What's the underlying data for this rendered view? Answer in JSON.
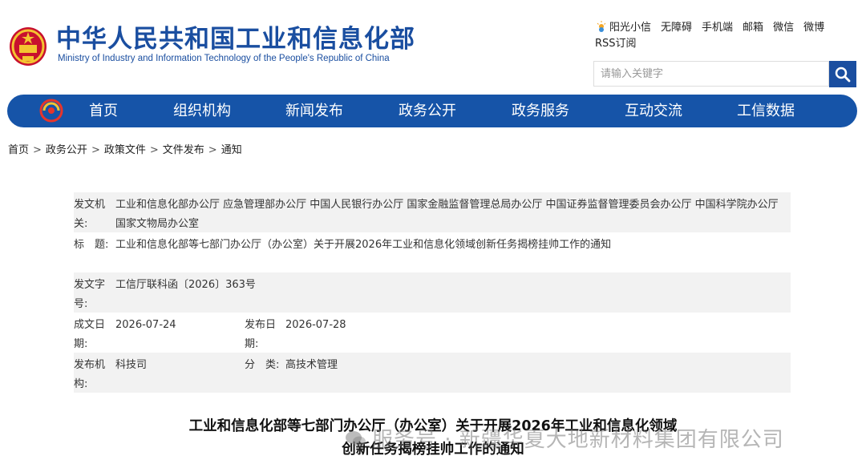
{
  "header": {
    "title": "中华人民共和国工业和信息化部",
    "subtitle": "Ministry of Industry and Information Technology of the People's Republic of China",
    "top_links": [
      "阳光小信",
      "无障碍",
      "手机端",
      "邮箱",
      "微信",
      "微博",
      "RSS订阅"
    ],
    "search_placeholder": "请输入关键字"
  },
  "nav": {
    "items": [
      "首页",
      "组织机构",
      "新闻发布",
      "政务公开",
      "政务服务",
      "互动交流",
      "工信数据"
    ]
  },
  "breadcrumb": [
    "首页",
    "政务公开",
    "政策文件",
    "文件发布",
    "通知"
  ],
  "meta": {
    "issuer_label": "发文机关:",
    "issuer_value": "工业和信息化部办公厅 应急管理部办公厅 中国人民银行办公厅 国家金融监督管理总局办公厅 中国证券监督管理委员会办公厅 中国科学院办公厅 国家文物局办公室",
    "title_label": "标　题:",
    "title_value": "工业和信息化部等七部门办公厅（办公室）关于开展2026年工业和信息化领域创新任务揭榜挂帅工作的通知",
    "docno_label": "发文字号:",
    "docno_value": "工信厅联科函〔2026〕363号",
    "written_label": "成文日期:",
    "written_value": "2026-07-24",
    "published_label": "发布日期:",
    "published_value": "2026-07-28",
    "org_label": "发布机构:",
    "org_value": "科技司",
    "category_label": "分　类:",
    "category_value": "高技术管理"
  },
  "document": {
    "title_line1": "工业和信息化部等七部门办公厅（办公室）关于开展2026年工业和信息化领域",
    "title_line2": "创新任务揭榜挂帅工作的通知"
  },
  "watermark": "服务号 · 新疆华夏大地新材料集团有限公司",
  "colors": {
    "brand": "#1654a8",
    "title": "#1a4ea0",
    "row_shade": "#f2f2f2"
  }
}
